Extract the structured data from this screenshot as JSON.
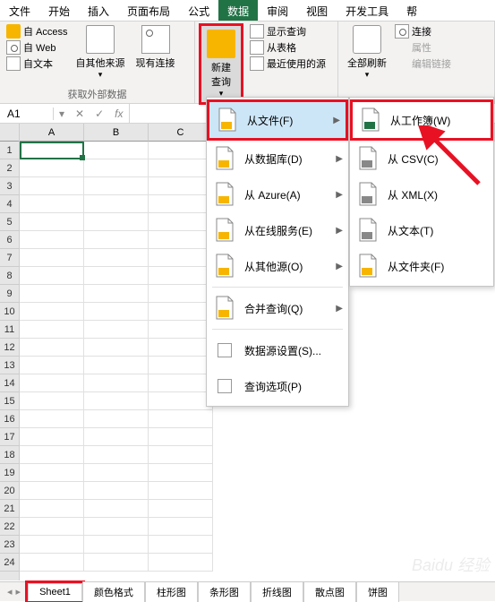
{
  "menubar": [
    "文件",
    "开始",
    "插入",
    "页面布局",
    "公式",
    "数据",
    "审阅",
    "视图",
    "开发工具",
    "帮"
  ],
  "menubar_active": 5,
  "ribbon": {
    "group1": {
      "items": [
        "自 Access",
        "自 Web",
        "自文本"
      ],
      "big": "自其他来源",
      "conn": "现有连接",
      "label": "获取外部数据"
    },
    "group2": {
      "big": "新建\n查询",
      "items": [
        "显示查询",
        "从表格",
        "最近使用的源"
      ]
    },
    "group3": {
      "big": "全部刷新",
      "items": [
        "连接",
        "属性",
        "编辑链接"
      ]
    }
  },
  "name_box": "A1",
  "fx": "fx",
  "cols": [
    "A",
    "B",
    "C"
  ],
  "rows": [
    "1",
    "2",
    "3",
    "4",
    "5",
    "6",
    "7",
    "8",
    "9",
    "10",
    "11",
    "12",
    "13",
    "14",
    "15",
    "16",
    "17",
    "18",
    "19",
    "20",
    "21",
    "22",
    "23",
    "24"
  ],
  "menu1": [
    {
      "label": "从文件(F)",
      "arrow": true,
      "hl": true
    },
    {
      "label": "从数据库(D)",
      "arrow": true
    },
    {
      "label": "从 Azure(A)",
      "arrow": true
    },
    {
      "label": "从在线服务(E)",
      "arrow": true
    },
    {
      "label": "从其他源(O)",
      "arrow": true
    },
    {
      "sep": true
    },
    {
      "label": "合并查询(Q)",
      "arrow": true
    },
    {
      "sep": true
    },
    {
      "label": "数据源设置(S)...",
      "small": true
    },
    {
      "label": "查询选项(P)",
      "small": true
    }
  ],
  "menu2": [
    {
      "label": "从工作簿(W)",
      "hl": true
    },
    {
      "label": "从 CSV(C)"
    },
    {
      "label": "从 XML(X)"
    },
    {
      "label": "从文本(T)"
    },
    {
      "label": "从文件夹(F)"
    }
  ],
  "sheets": {
    "active": "Sheet1",
    "others": [
      "颜色格式",
      "柱形图",
      "条形图",
      "折线图",
      "散点图",
      "饼图"
    ]
  },
  "watermark": "Baidu 经验"
}
